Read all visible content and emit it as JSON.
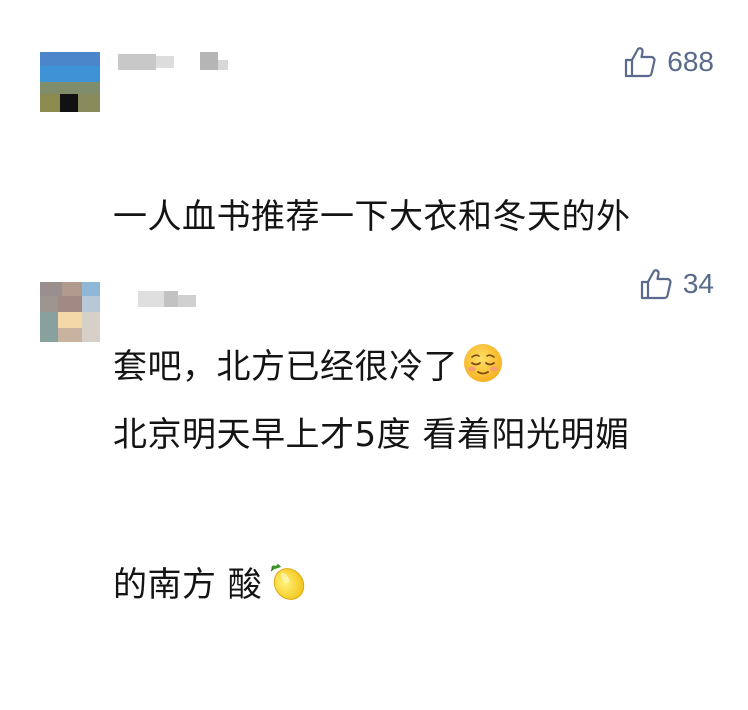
{
  "comments": [
    {
      "likes": "688",
      "text_line1": "一人血书推荐一下大衣和冬天的外",
      "text_line2": "套吧，北方已经很冷了",
      "emoji": "relieved-face"
    },
    {
      "likes": "34",
      "text_line1": "北京明天早上才5度 看着阳光明媚",
      "text_line2": "的南方 酸",
      "emoji": "lemon"
    }
  ],
  "colors": {
    "like": "#596a8c",
    "text": "#141414"
  }
}
